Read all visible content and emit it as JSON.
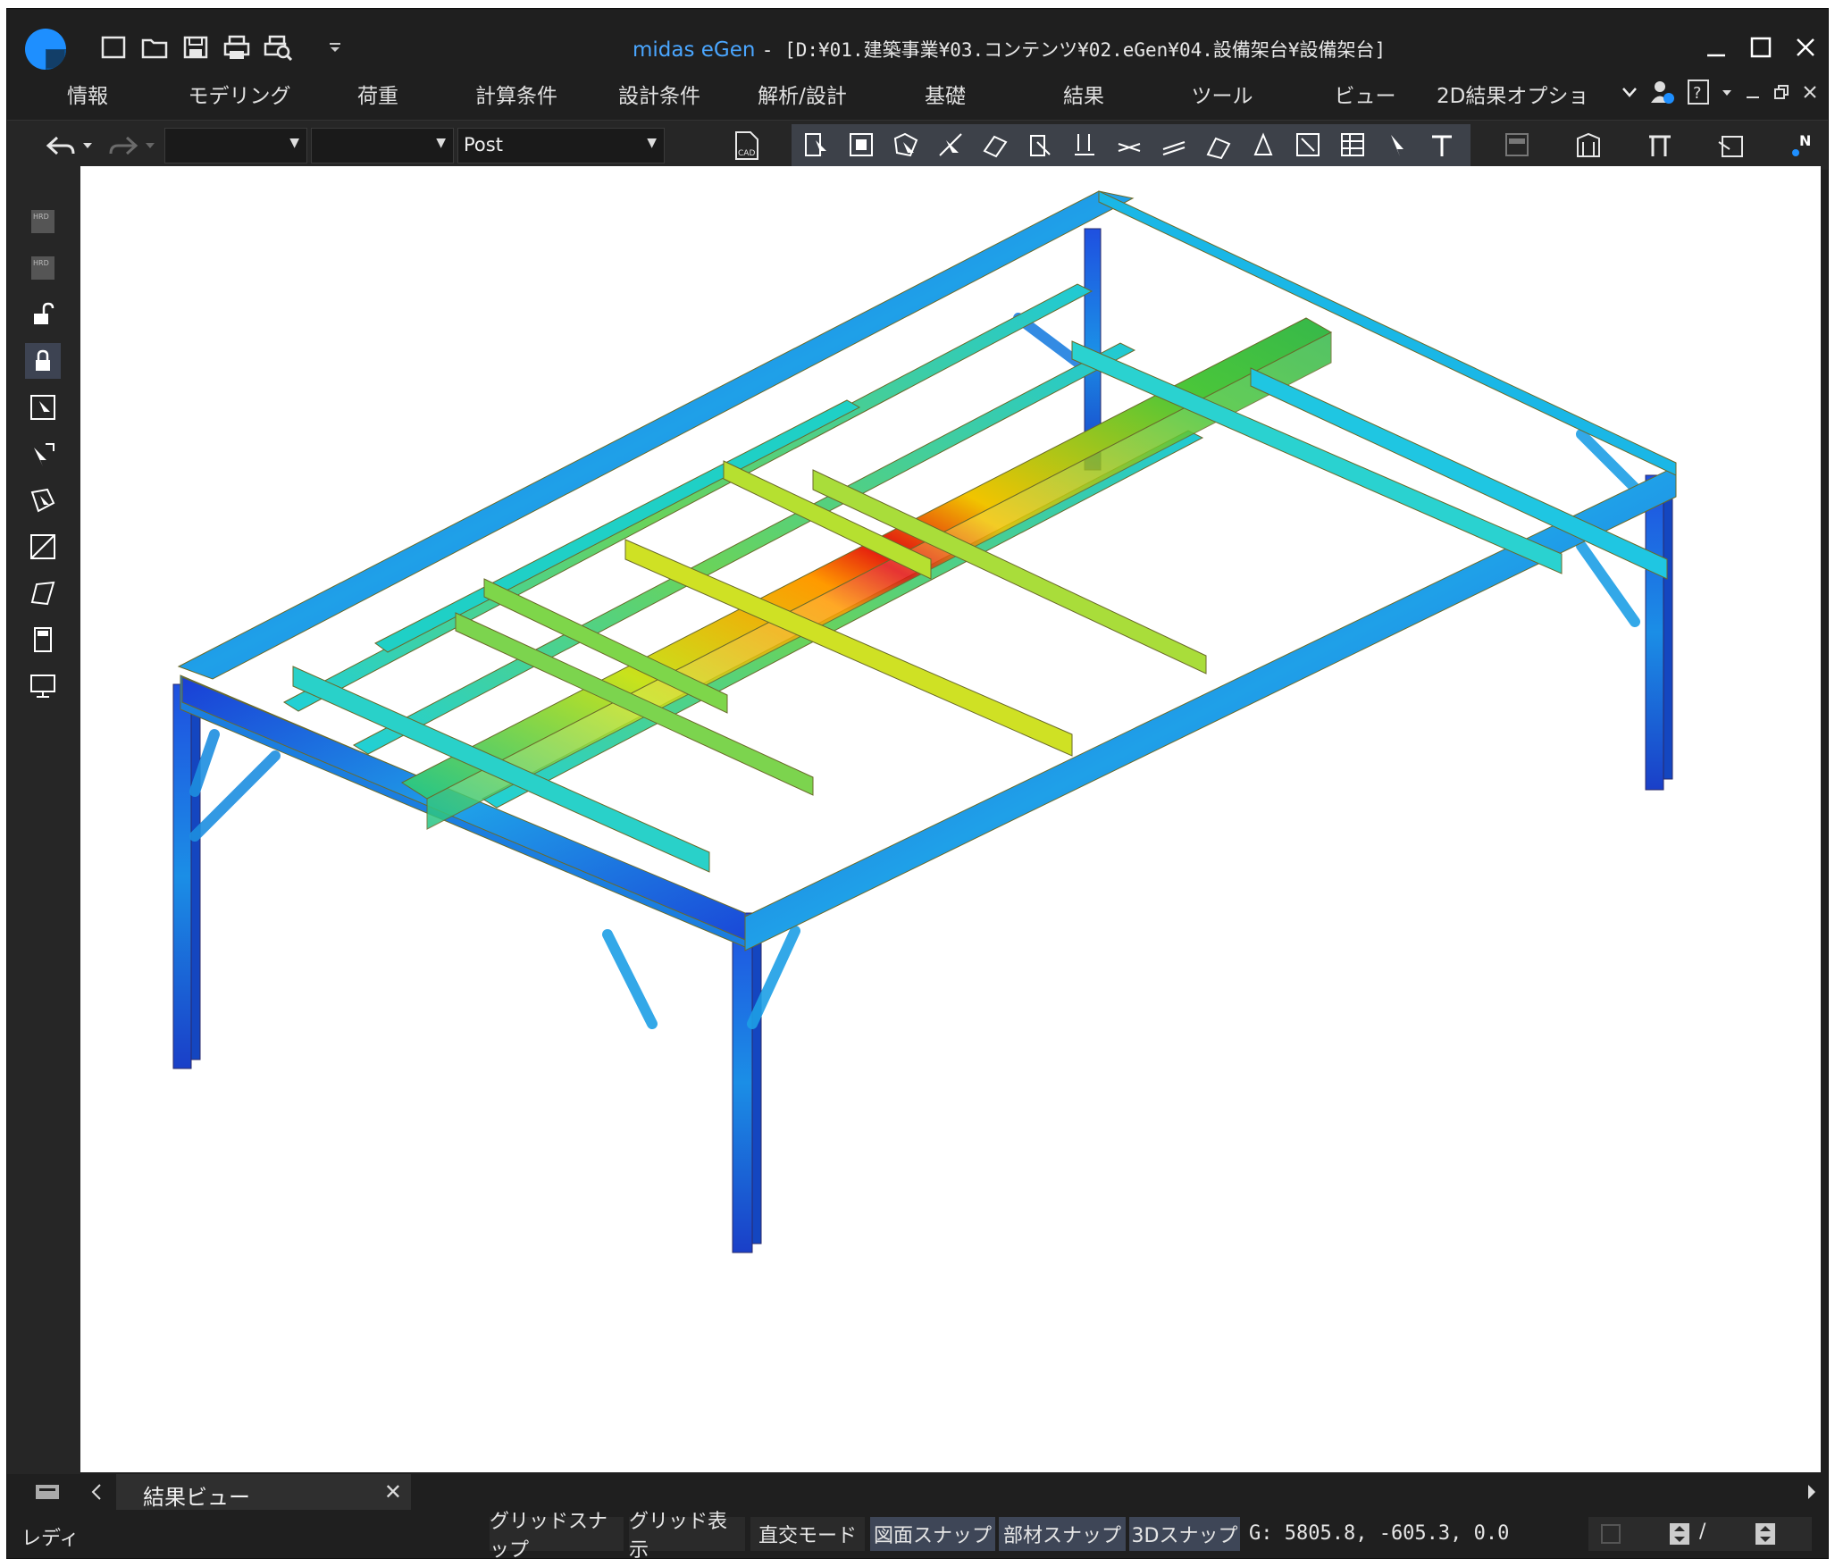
{
  "window": {
    "app_name": "midas eGen",
    "path": " - [D:¥01.建築事業¥03.コンテンツ¥02.eGen¥04.設備架台¥設備架台]"
  },
  "quick_access": [
    "new-file-icon",
    "open-folder-icon",
    "save-icon",
    "print-icon",
    "print-preview-icon",
    "customize-dropdown-icon"
  ],
  "menu": [
    {
      "label": "情報"
    },
    {
      "label": "モデリング"
    },
    {
      "label": "荷重"
    },
    {
      "label": "計算条件"
    },
    {
      "label": "設計条件"
    },
    {
      "label": "解析/設計"
    },
    {
      "label": "基礎"
    },
    {
      "label": "結果"
    },
    {
      "label": "ツール"
    },
    {
      "label": "ビュー"
    },
    {
      "label": "2D結果オプショ"
    }
  ],
  "toolbar": {
    "select1": "",
    "select2": "",
    "select3": "Post"
  },
  "tab": {
    "label": "結果ビュー"
  },
  "status": {
    "ready": "レディ",
    "buttons": [
      {
        "label": "グリッドスナップ",
        "active": false
      },
      {
        "label": "グリッド表示",
        "active": false
      },
      {
        "label": "直交モード",
        "active": false
      },
      {
        "label": "図面スナップ",
        "active": true
      },
      {
        "label": "部材スナップ",
        "active": true
      },
      {
        "label": "3Dスナップ",
        "active": true
      }
    ],
    "coordinates": "G: 5805.8, -605.3, 0.0",
    "slash": "/"
  },
  "colors": {
    "accent": "#1e8fff",
    "background": "#1f1f1f",
    "active_button": "#3e4657"
  }
}
